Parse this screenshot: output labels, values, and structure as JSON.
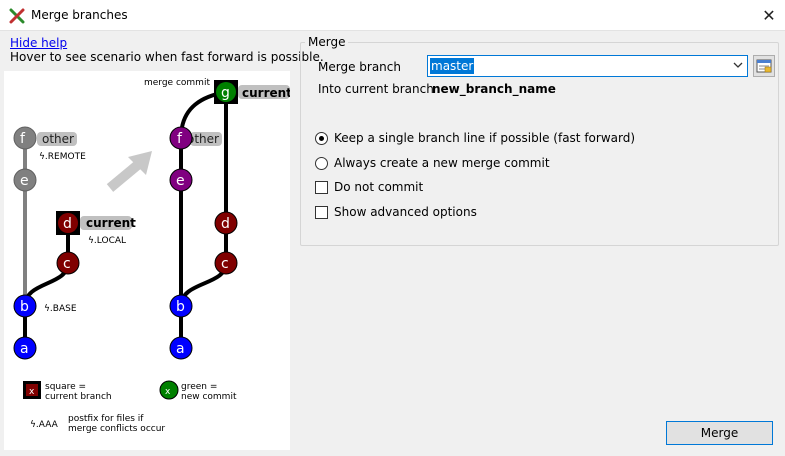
{
  "window": {
    "title": "Merge branches",
    "close_glyph": "✕"
  },
  "help": {
    "hide_label": "Hide help",
    "hover_text": "Hover to see scenario when fast forward is possible."
  },
  "diagram": {
    "merge_commit_label": "merge commit",
    "left": {
      "other_label": "other",
      "remote_label": "ϟ.REMOTE",
      "current_label": "current",
      "local_label": "ϟ.LOCAL",
      "base_label": "ϟ.BASE",
      "nodes": {
        "f": "f",
        "e": "e",
        "d": "d",
        "c": "c",
        "b": "b",
        "a": "a"
      }
    },
    "right": {
      "current_label": "current",
      "other_label": "other",
      "nodes": {
        "g": "g",
        "f": "f",
        "e": "e",
        "d": "d",
        "c": "c",
        "b": "b",
        "a": "a"
      }
    },
    "legend": {
      "square_marker": "x",
      "square_line1": "square =",
      "square_line2": "current branch",
      "green_marker": "x",
      "green_line1": "green =",
      "green_line2": "new commit",
      "postfix_marker": "ϟ.AAA",
      "postfix_line1": "postfix for files if",
      "postfix_line2": "merge conflicts occur"
    },
    "colors": {
      "gray": "#808080",
      "purple": "#800080",
      "darkred": "#800000",
      "blue": "#0000ff",
      "green": "#008000",
      "arrow": "#c8c8c8"
    }
  },
  "merge_group": {
    "title": "Merge",
    "merge_branch_label": "Merge branch",
    "merge_branch_value": "master",
    "into_label": "Into current branch",
    "into_value": "new_branch_name",
    "options": [
      {
        "type": "radio",
        "checked": true,
        "label": "Keep a single branch line if possible (fast forward)"
      },
      {
        "type": "radio",
        "checked": false,
        "label": "Always create a new merge commit"
      },
      {
        "type": "checkbox",
        "checked": false,
        "label": "Do not commit"
      },
      {
        "type": "checkbox",
        "checked": false,
        "label": "Show advanced options"
      }
    ]
  },
  "buttons": {
    "merge": "Merge"
  }
}
